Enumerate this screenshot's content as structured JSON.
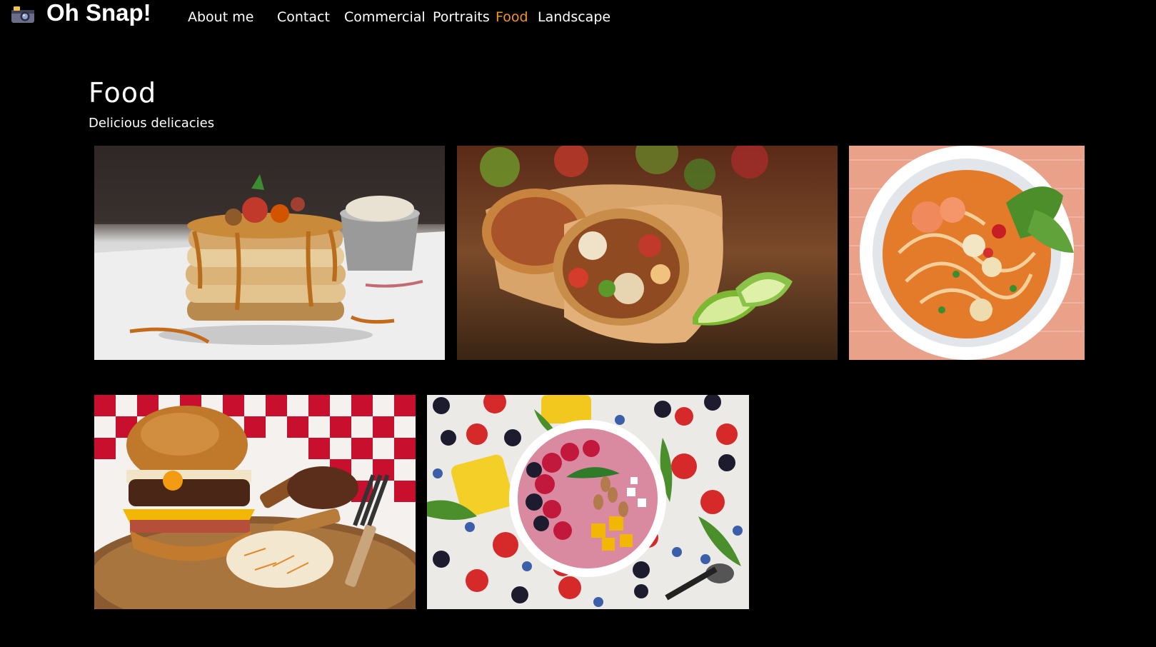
{
  "header": {
    "logo_icon": "camera-icon",
    "brand": "Oh Snap!"
  },
  "nav": {
    "items": [
      {
        "label": "About me"
      },
      {
        "label": "Contact"
      },
      {
        "label": "Commercial"
      },
      {
        "label": "Portraits"
      },
      {
        "label": "Food",
        "active": true
      },
      {
        "label": "Landscape"
      }
    ]
  },
  "main": {
    "title": "Food",
    "subtitle": "Delicious delicacies"
  },
  "gallery": {
    "photos": [
      {
        "subject": "pancakes"
      },
      {
        "subject": "burrito"
      },
      {
        "subject": "noodle-soup"
      },
      {
        "subject": "burger"
      },
      {
        "subject": "fruit-bowl"
      }
    ]
  },
  "colors": {
    "background": "#000000",
    "text": "#ffffff",
    "accent": "#f0932b"
  }
}
